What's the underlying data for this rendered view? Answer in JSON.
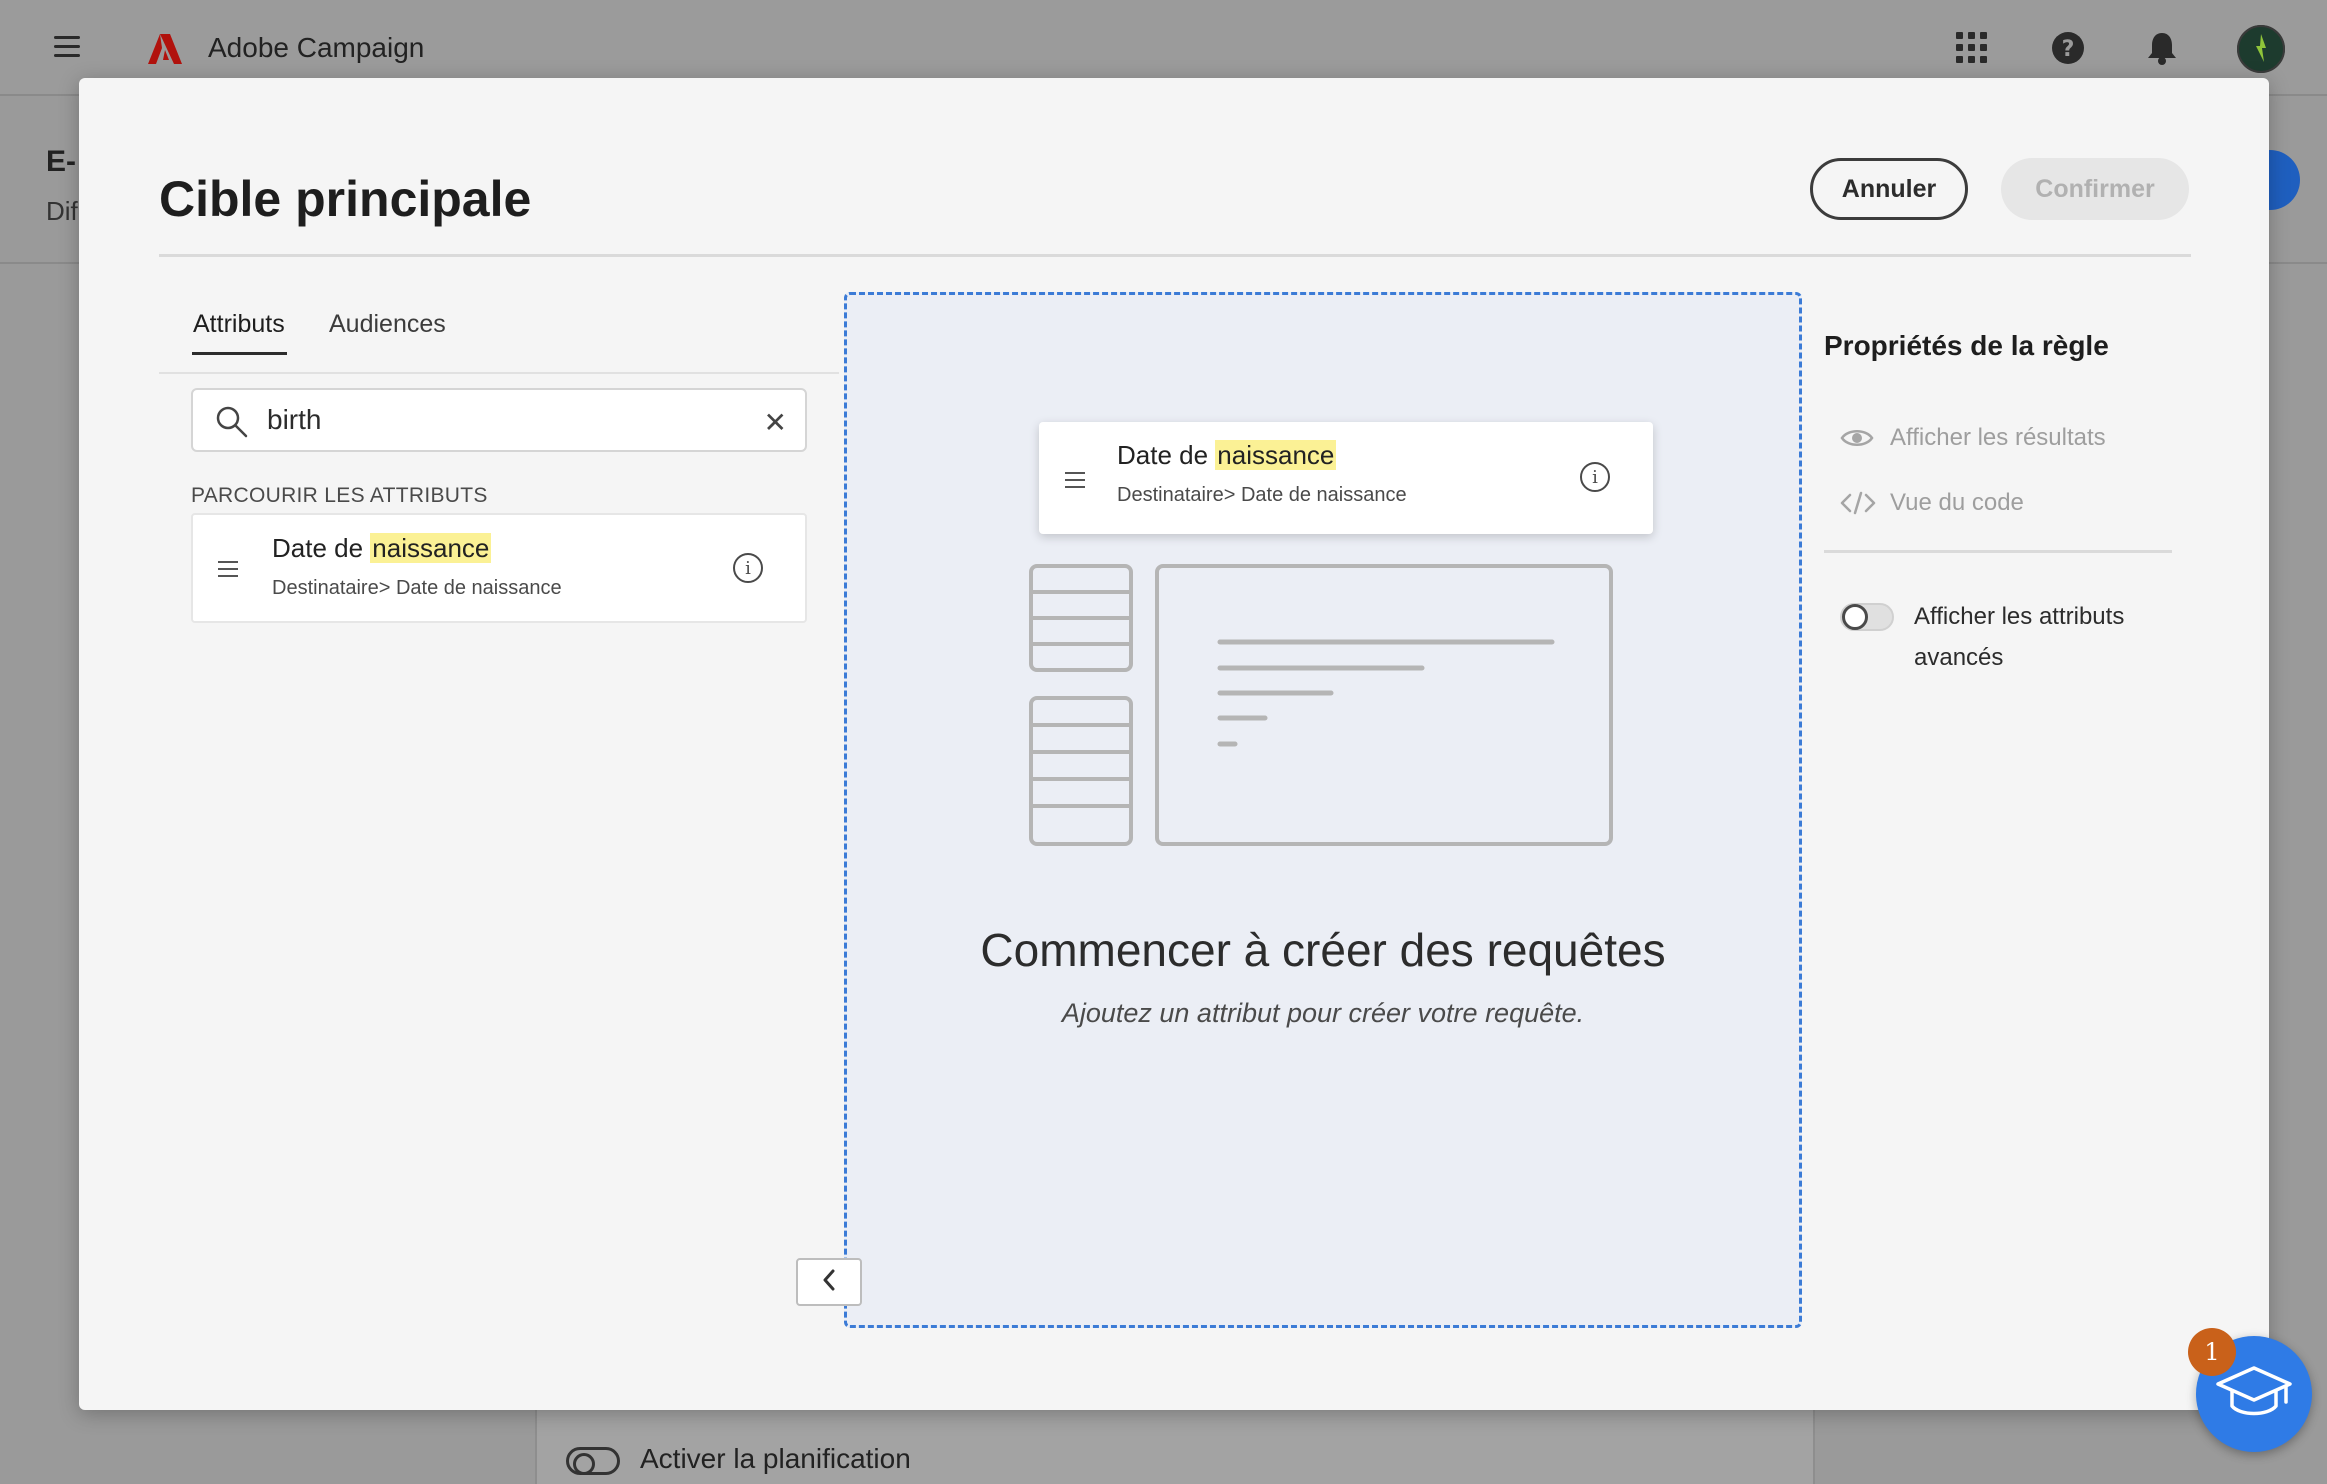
{
  "app": {
    "title": "Adobe Campaign",
    "icons": [
      "hamburger-icon",
      "adobe-logo-icon",
      "apps-grid-icon",
      "help-icon",
      "bell-icon",
      "avatar"
    ]
  },
  "background": {
    "page_title_fragment": "E-",
    "page_subtitle_fragment": "Dif",
    "schedule_toggle_label": "Activer la planification"
  },
  "modal": {
    "title": "Cible principale",
    "cancel_label": "Annuler",
    "confirm_label": "Confirmer",
    "tabs": [
      {
        "label": "Attributs",
        "active": true
      },
      {
        "label": "Audiences",
        "active": false
      }
    ],
    "search": {
      "value": "birth"
    },
    "browse_label": "PARCOURIR LES ATTRIBUTS",
    "attribute": {
      "title_prefix": "Date de ",
      "title_highlight": "naissance",
      "path": "Destinataire> Date de naissance"
    },
    "canvas": {
      "empty_title": "Commencer à créer des requêtes",
      "empty_subtitle": "Ajoutez un attribut pour créer votre requête."
    },
    "rule_properties": {
      "title": "Propriétés de la règle",
      "show_results": "Afficher les résultats",
      "code_view": "Vue du code",
      "advanced_attributes": "Afficher les attributs avancés"
    }
  },
  "help_fab": {
    "badge_count": "1"
  },
  "colors": {
    "accent_blue": "#2f7be6",
    "dropzone_border": "#3b7bd6",
    "highlight": "#fbf195",
    "badge": "#c9611a",
    "overlay": "#9a9a9a"
  }
}
